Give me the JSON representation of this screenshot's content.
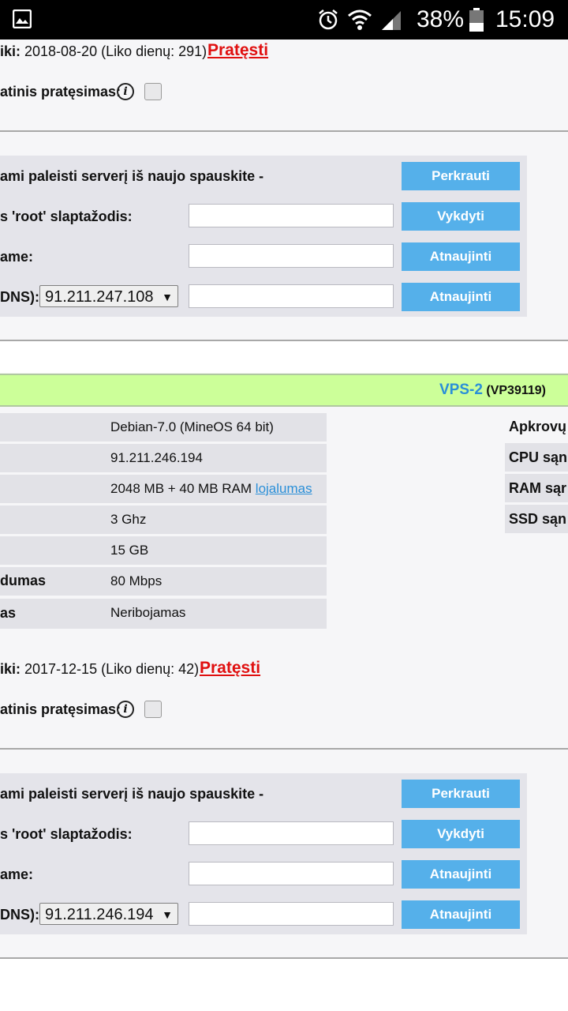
{
  "status_bar": {
    "battery": "38%",
    "time": "15:09"
  },
  "vps1": {
    "expiry_label": "iki:",
    "expiry_value": "2018-08-20 (Liko dienų: 291)",
    "renew_link": "Pratęsti",
    "auto_renew_label": "atinis pratęsimas:",
    "restart_label": "ami paleisti serverį iš naujo spauskite -",
    "restart_button": "Perkrauti",
    "root_label": "s 'root' slaptažodis:",
    "root_button": "Vykdyti",
    "hostname_label": "ame:",
    "hostname_button": "Atnaujinti",
    "rdns_label": "DNS):",
    "rdns_selected": "91.211.247.108",
    "rdns_button": "Atnaujinti"
  },
  "vps2": {
    "name": "VPS-2",
    "code": "(VP39119)",
    "specs": [
      {
        "label": "",
        "value": "Debian-7.0 (MineOS 64 bit)"
      },
      {
        "label": "",
        "value": "91.211.246.194"
      },
      {
        "label": "",
        "value": "2048 MB + 40 MB RAM",
        "link": "lojalumas"
      },
      {
        "label": "",
        "value": "3 Ghz"
      },
      {
        "label": "",
        "value": "15 GB"
      },
      {
        "label": "dumas",
        "value": "80 Mbps"
      },
      {
        "label": "as",
        "value": "Neribojamas"
      }
    ],
    "load_rows": [
      "Apkrovų",
      "CPU sąn",
      "RAM sąr",
      "SSD sąn"
    ],
    "expiry_label": "iki:",
    "expiry_value": "2017-12-15 (Liko dienų: 42)",
    "renew_link": "Pratęsti",
    "auto_renew_label": "atinis pratęsimas:",
    "restart_label": "ami paleisti serverį iš naujo spauskite -",
    "restart_button": "Perkrauti",
    "root_label": "s 'root' slaptažodis:",
    "root_button": "Vykdyti",
    "hostname_label": "ame:",
    "hostname_button": "Atnaujinti",
    "rdns_label": "DNS):",
    "rdns_selected": "91.211.246.194",
    "rdns_button": "Atnaujinti"
  }
}
